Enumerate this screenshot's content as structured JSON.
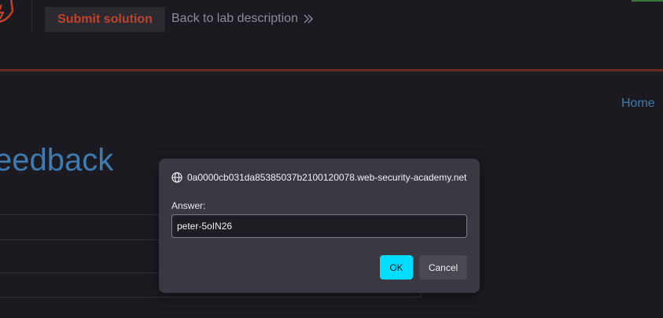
{
  "header": {
    "logo_icon": "lab-logo-icon",
    "submit_label": "Submit solution",
    "back_label": "Back to lab description",
    "back_icon": "double-chevron-right-icon"
  },
  "nav": {
    "home_label": "Home"
  },
  "page": {
    "title": "eedback"
  },
  "dialog": {
    "origin_icon": "globe-icon",
    "origin": "0a0000cb031da85385037b2100120078.web-security-academy.net",
    "label": "Answer:",
    "input_value": "peter-5oIN26",
    "ok_label": "OK",
    "cancel_label": "Cancel"
  },
  "colors": {
    "background": "#1b1a20",
    "accent_red": "#c0432d",
    "link_blue": "#3f7bb0",
    "ok_cyan": "#00ddff",
    "dialog_bg": "#3a3942"
  }
}
